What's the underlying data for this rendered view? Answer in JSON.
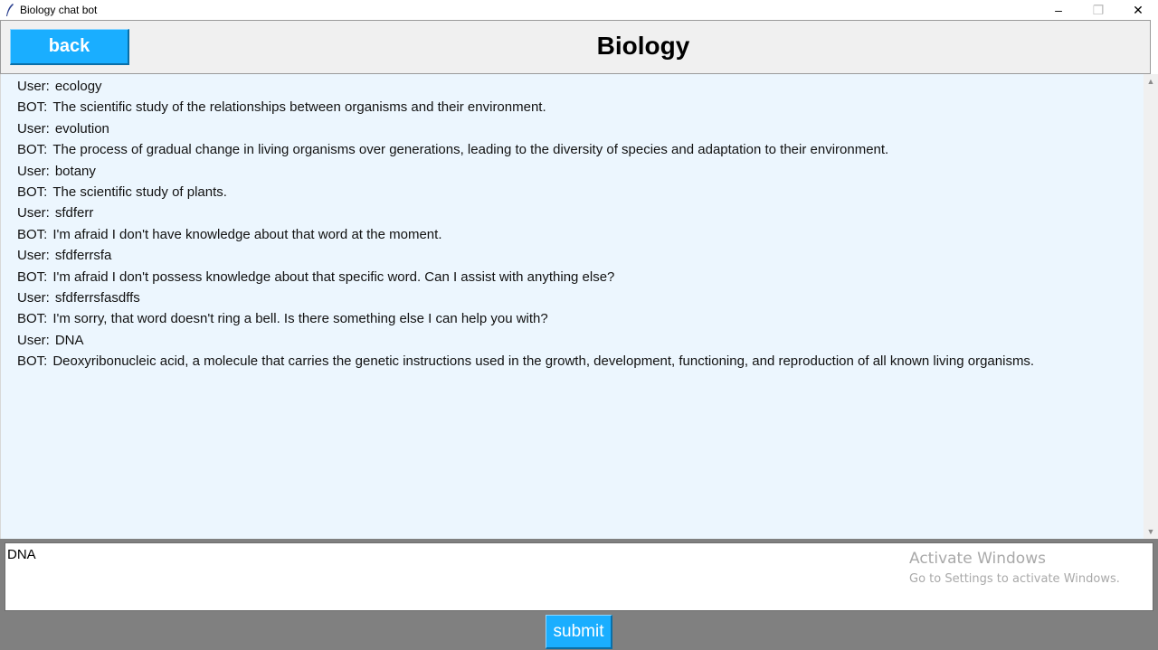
{
  "window": {
    "title": "Biology chat bot",
    "icon": "feather-icon",
    "controls": {
      "minimize": "–",
      "restore": "❐",
      "close": "✕"
    }
  },
  "header": {
    "back_label": "back",
    "title": "Biology"
  },
  "chat": {
    "messages": [
      {
        "speaker": "User:",
        "text": "ecology"
      },
      {
        "speaker": "BOT:",
        "text": "The scientific study of the relationships between organisms and their environment."
      },
      {
        "speaker": "User:",
        "text": "evolution"
      },
      {
        "speaker": "BOT:",
        "text": "The process of gradual change in living organisms over generations, leading to the diversity of species and adaptation to their environment."
      },
      {
        "speaker": "User:",
        "text": "botany"
      },
      {
        "speaker": "BOT:",
        "text": "The scientific study of plants."
      },
      {
        "speaker": "User:",
        "text": "sfdferr"
      },
      {
        "speaker": "BOT:",
        "text": "I'm afraid I don't have knowledge about that word at the moment."
      },
      {
        "speaker": "User:",
        "text": "sfdferrsfa"
      },
      {
        "speaker": "BOT:",
        "text": "I'm afraid I don't possess knowledge about that specific word. Can I assist with anything else?"
      },
      {
        "speaker": "User:",
        "text": "sfdferrsfasdffs"
      },
      {
        "speaker": "BOT:",
        "text": "I'm sorry, that word doesn't ring a bell. Is there something else I can help you with?"
      },
      {
        "speaker": "User:",
        "text": "DNA"
      },
      {
        "speaker": "BOT:",
        "text": "Deoxyribonucleic acid, a molecule that carries the genetic instructions used in the growth, development, functioning, and reproduction of all known living organisms."
      }
    ]
  },
  "input": {
    "value": "DNA"
  },
  "watermark": {
    "line1": "Activate Windows",
    "line2": "Go to Settings to activate Windows."
  },
  "submit_label": "submit",
  "colors": {
    "button_bg": "#1aaeff",
    "chat_bg": "#ecf6fe",
    "panel_bg": "#808080",
    "header_bg": "#f0f0f0"
  }
}
